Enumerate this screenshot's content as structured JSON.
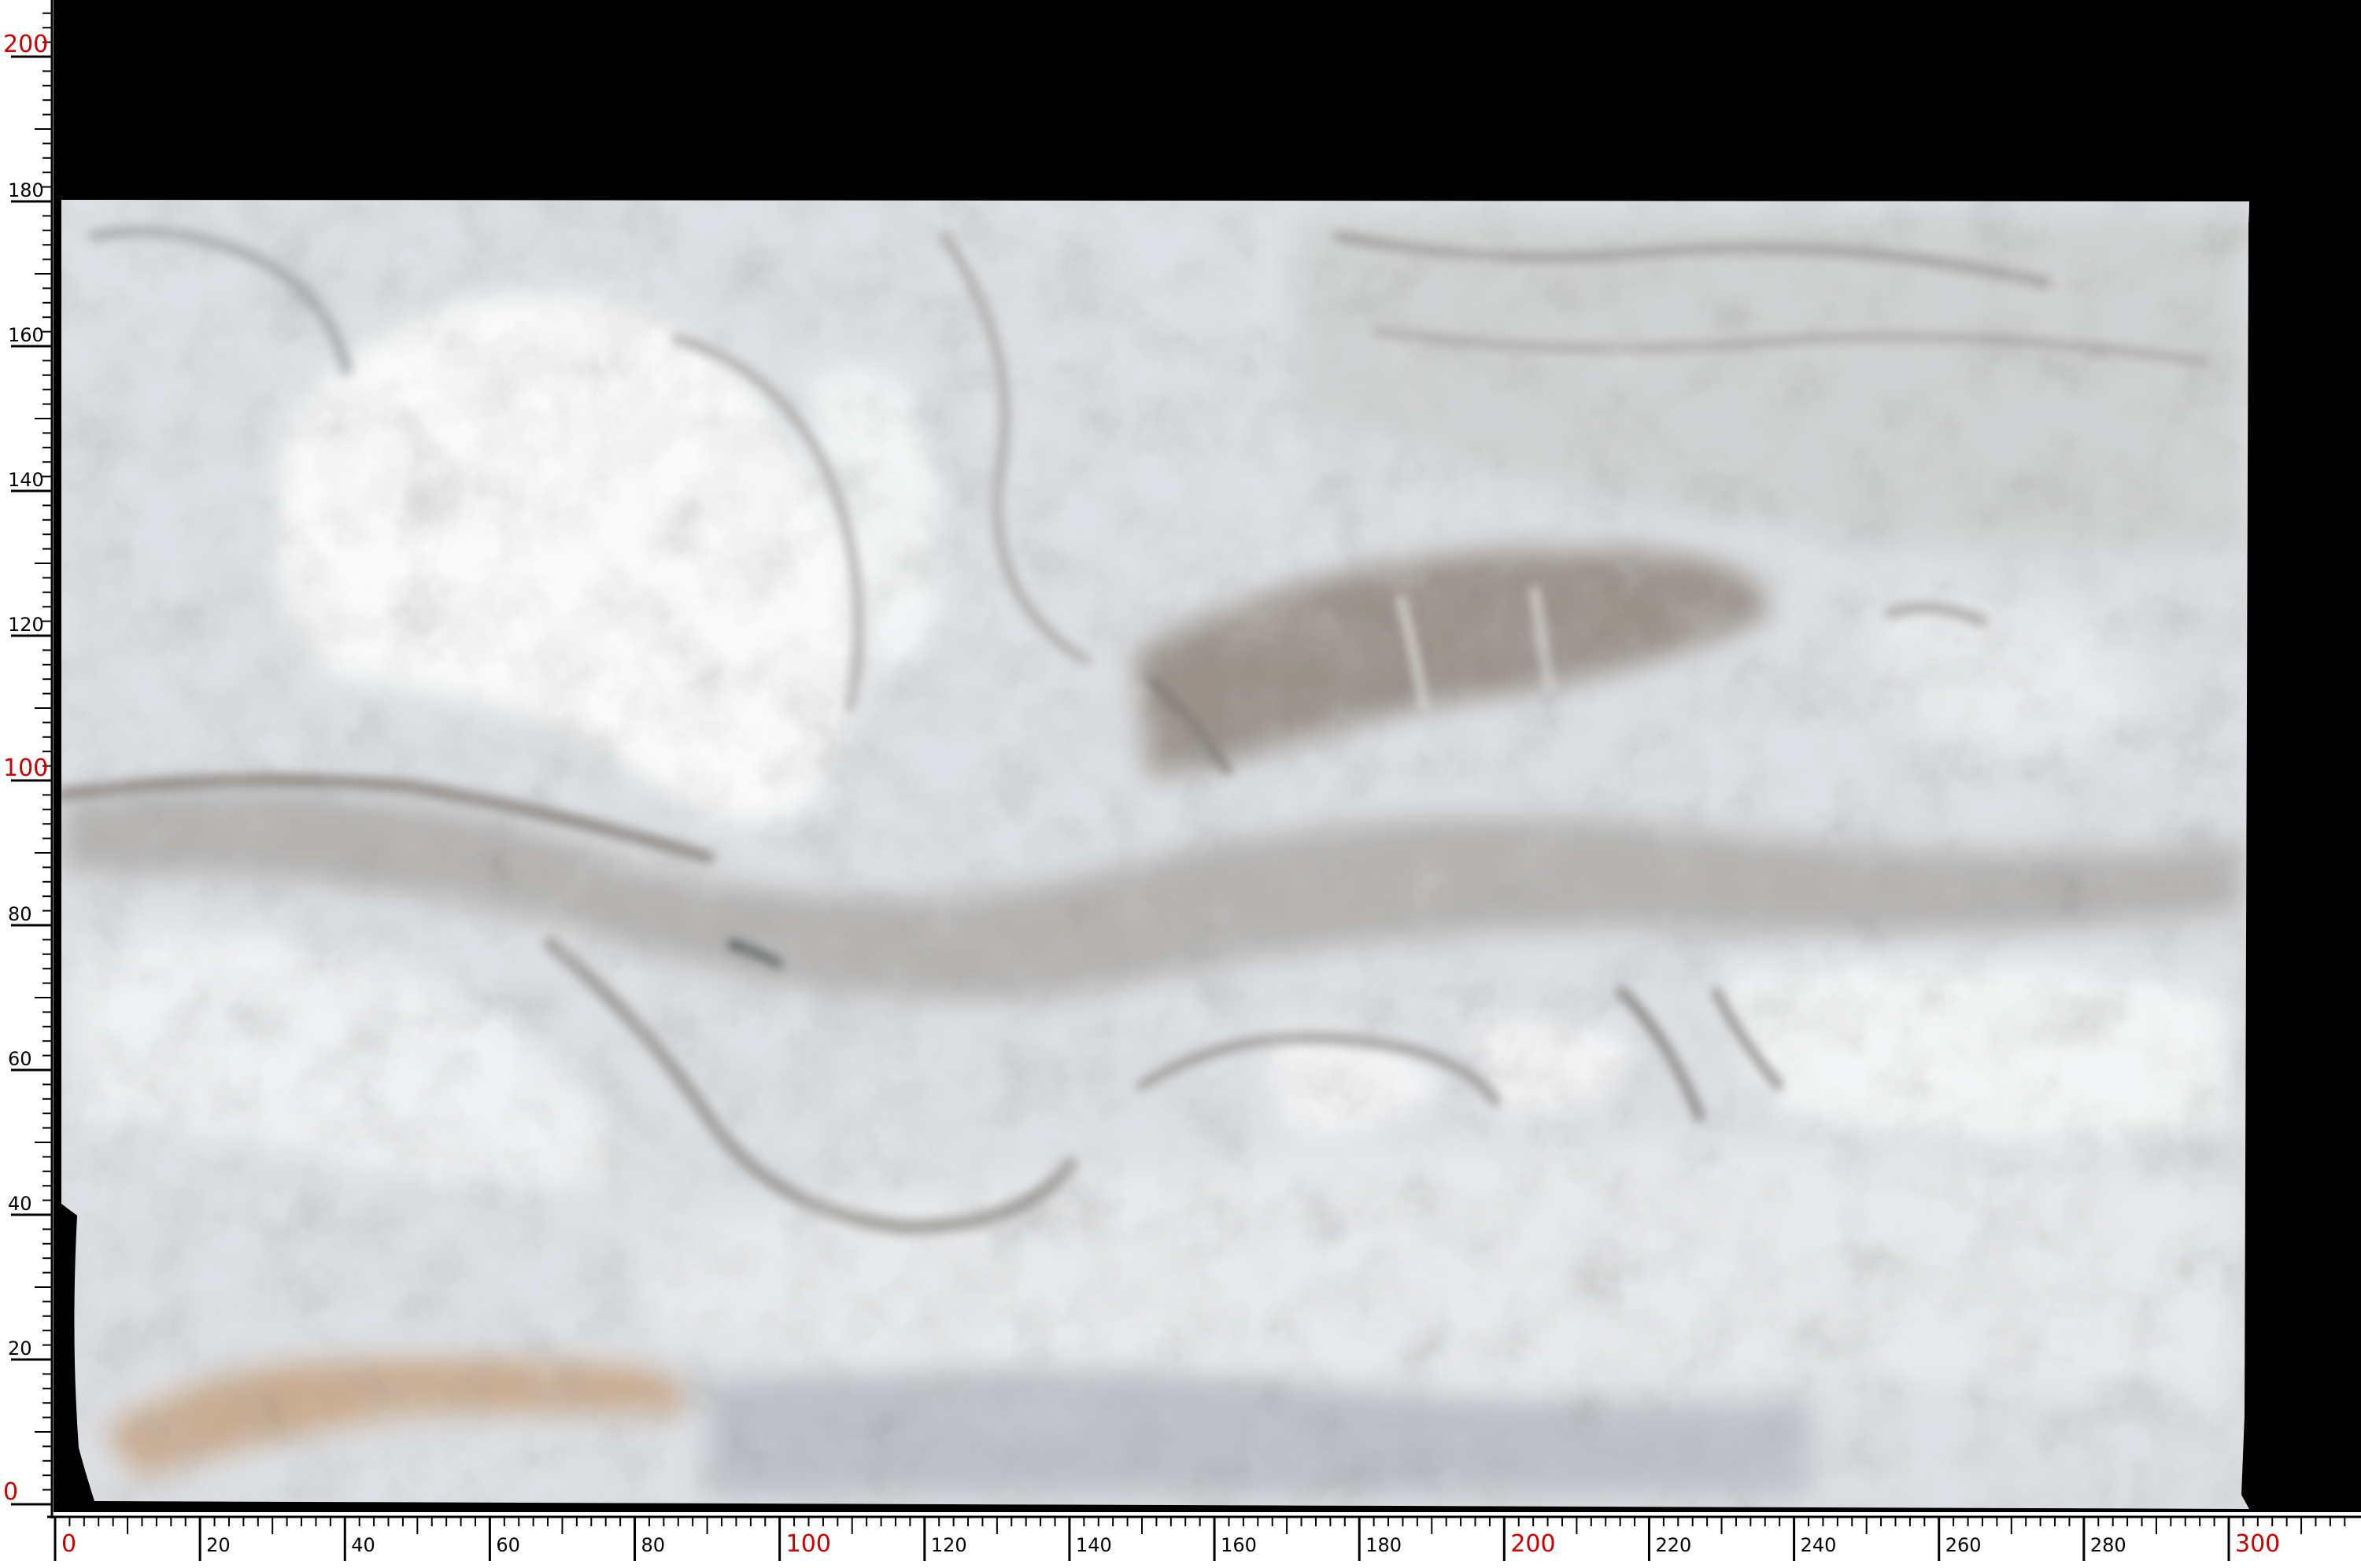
{
  "image": {
    "subject": "marble-slab",
    "background_color": "#000000",
    "ruler_color": "#ffffff",
    "tick_color": "#000000",
    "label_color_major": "#cc0000",
    "label_color_minor": "#000000"
  },
  "ruler_x": {
    "min": 0,
    "max": 300,
    "minor_step": 2,
    "label_step": 20,
    "highlight_step": 100,
    "labels": [
      "0",
      "20",
      "40",
      "60",
      "80",
      "100",
      "120",
      "140",
      "160",
      "180",
      "200",
      "220",
      "240",
      "260",
      "280",
      "300"
    ]
  },
  "ruler_y": {
    "min": 0,
    "max": 200,
    "minor_step": 2,
    "label_step": 20,
    "highlight_step": 100,
    "labels": [
      "0",
      "20",
      "40",
      "60",
      "80",
      "100",
      "120",
      "140",
      "160",
      "180",
      "200"
    ]
  },
  "slab": {
    "width_units": 301,
    "height_units": 181,
    "base_color": "#dfe1e4",
    "vein_color": "#8e8882",
    "white_color": "#f7f8f8",
    "rust_color": "#c9ab8f"
  }
}
